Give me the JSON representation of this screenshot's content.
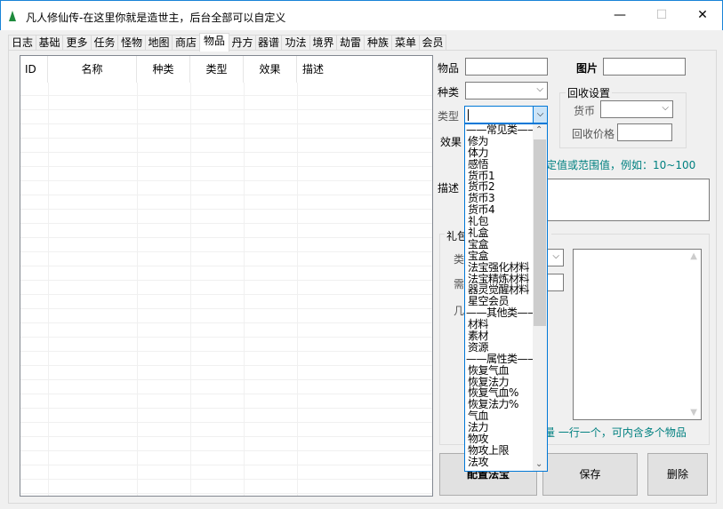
{
  "window": {
    "title": "凡人修仙传-在这里你就是造世主，后台全部可以自定义",
    "minimize": "—",
    "maximize": "☐",
    "close": "✕"
  },
  "tabs": [
    "日志",
    "基础",
    "更多",
    "任务",
    "怪物",
    "地图",
    "商店",
    "物品",
    "丹方",
    "器谱",
    "功法",
    "境界",
    "劫雷",
    "种族",
    "菜单",
    "会员"
  ],
  "selected_tab": "物品",
  "list": {
    "columns": [
      "ID",
      "名称",
      "种类",
      "类型",
      "效果",
      "描述"
    ]
  },
  "form": {
    "item_label": "物品",
    "item_value": "",
    "image_label": "图片",
    "image_value": "",
    "kind_label": "种类",
    "kind_value": "",
    "type_label": "类型",
    "type_value": "",
    "effect_label": "效果",
    "effect_hint": "定值或范围值，例如：10~100",
    "desc_label": "描述",
    "recycle": {
      "title": "回收设置",
      "currency_label": "货币",
      "currency_value": "",
      "price_label": "回收价格",
      "price_value": ""
    },
    "gift": {
      "title": "礼包",
      "type_label": "类",
      "need_label": "需",
      "rate_label": "几",
      "hint": "量 一行一个，可内含多个物品"
    }
  },
  "buttons": {
    "config": "配置法宝",
    "save": "保存",
    "delete": "删除"
  },
  "dropdown_items": [
    "——常见类——",
    "修为",
    "体力",
    "感悟",
    "货币1",
    "货币2",
    "货币3",
    "货币4",
    "礼包",
    "礼盒",
    "宝盒",
    "宝盒",
    "法宝强化材料",
    "法宝精炼材料",
    "器灵觉醒材料",
    "星空会员",
    "——其他类——",
    "材料",
    "素材",
    "资源",
    "——属性类——",
    "恢复气血",
    "恢复法力",
    "恢复气血%",
    "恢复法力%",
    "气血",
    "法力",
    "物攻",
    "物攻上限",
    "法攻"
  ],
  "colors": {
    "accent": "#0078d7",
    "hint": "#008080"
  }
}
